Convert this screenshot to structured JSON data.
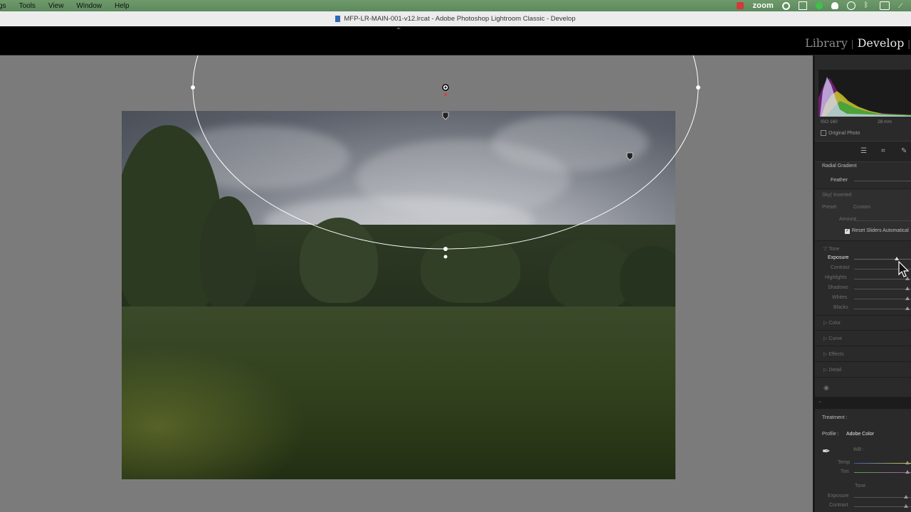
{
  "menubar": {
    "items": [
      "gs",
      "Tools",
      "View",
      "Window",
      "Help"
    ],
    "zoom_label": "zoom"
  },
  "titlebar": {
    "title": "MFP-LR-MAIN-001-v12.lrcat - Adobe Photoshop Lightroom Classic - Develop"
  },
  "modules": {
    "library": "Library",
    "develop": "Develop"
  },
  "histogram": {
    "iso": "ISO 160",
    "focal": "28 mm",
    "original_photo": "Original Photo"
  },
  "mask": {
    "title": "Radial Gradient",
    "feather_label": "Feather",
    "mask_name": "Sky( Inverted",
    "preset_label": "Preset",
    "preset_value": "Custom",
    "amount_label": "Amount",
    "reset_label": "Reset Sliders Automatical"
  },
  "tone": {
    "title": "Tone",
    "sliders": [
      "Exposure",
      "Contrast",
      "Highlights",
      "Shadows",
      "Whites",
      "Blacks"
    ]
  },
  "sections": [
    "Color",
    "Curve",
    "Effects",
    "Detail"
  ],
  "basic": {
    "treatment_label": "Treatment :",
    "profile_label": "Profile :",
    "profile_value": "Adobe Color",
    "wb_label": "WB :",
    "temp_label": "Temp",
    "tint_label": "Tint",
    "tone_title": "Tone",
    "exposure_label": "Exposure",
    "contrast_label": "Contrast"
  },
  "colors": {
    "accent_white": "#ffffff",
    "panel_bg": "#2a2a2a",
    "pin_red": "#d94040"
  }
}
